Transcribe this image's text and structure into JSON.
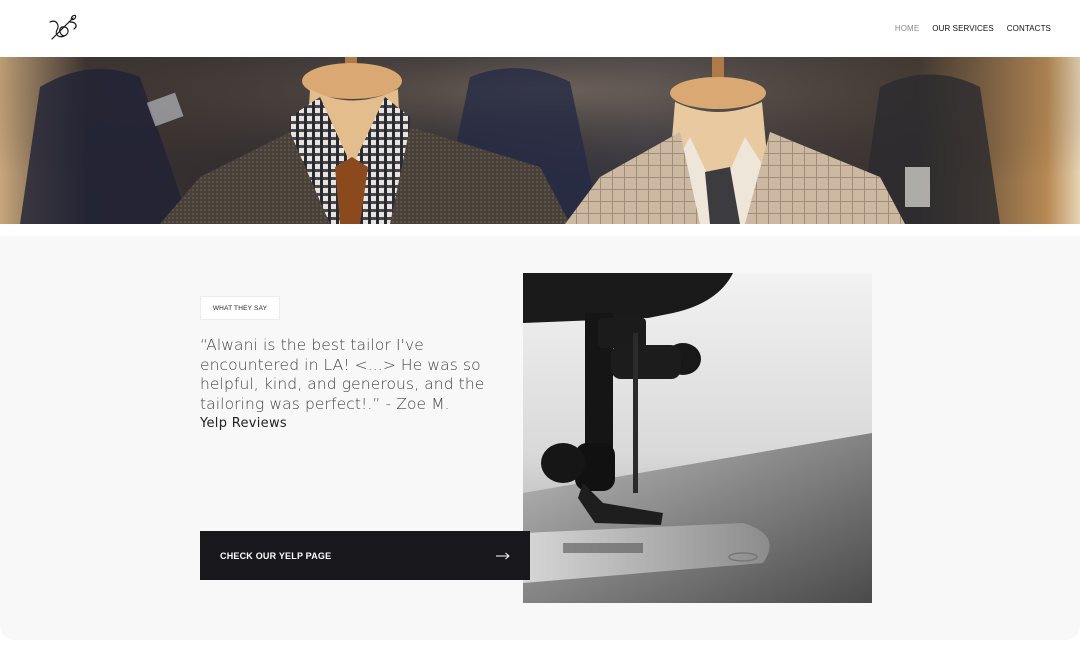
{
  "nav": {
    "items": [
      {
        "label": "HOME",
        "active": true
      },
      {
        "label": "OUR SERVICES",
        "active": false
      },
      {
        "label": "CONTACTS",
        "active": false
      }
    ]
  },
  "testimonial": {
    "badge": "WHAT THEY SAY",
    "quote": "“Alwani is the best tailor I've encountered in LA! <...> He was so helpful, kind, and generous, and the tailoring was perfect!.” - Zoe M.",
    "source": "Yelp Reviews"
  },
  "cta": {
    "label": "CHECK OUR YELP PAGE",
    "icon": "arrow-right-icon"
  },
  "icons": {
    "logo": "needle-thread-logo"
  },
  "colors": {
    "cta_background": "#18171c",
    "section_background": "#f8f8f8",
    "nav_active": "#8a8a8a"
  }
}
